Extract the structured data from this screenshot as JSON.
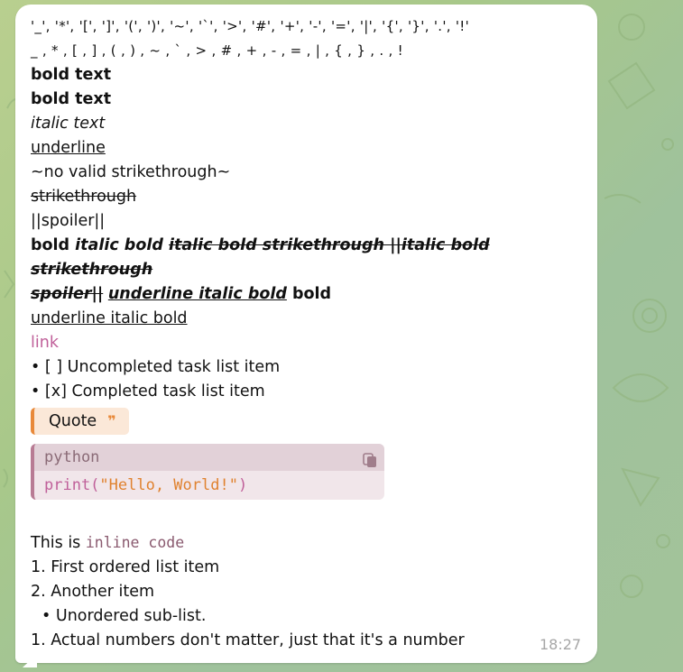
{
  "message": {
    "escaped_symbols": "'_', '*', '[', ']', '(', ')', '~', '`', '>', '#', '+', '-', '=', '|', '{', '}', '.', '!'",
    "plain_symbols": "_ , * , [ , ] , ( , ) , ~ , ` , > , # , + , - , = , | , { , } , . , !",
    "bold_1": "bold text",
    "bold_2": "bold text",
    "italic": "italic text",
    "underline": "underline",
    "invalid_strike": "~no valid strikethrough~",
    "strike": "strikethrough",
    "spoiler": "||spoiler||",
    "mixed": {
      "bold": "bold ",
      "italic_bold": "italic bold ",
      "italic_bold_strike": "italic bold strikethrough ||italic bold strikethrough",
      "spoiler_end": "spoiler||",
      "underline_italic_bold": "underline italic bold",
      "bold_end": " bold"
    },
    "underline_italic_bold": "underline italic bold",
    "link": "link",
    "task_1": "• [ ] Uncompleted task list item",
    "task_2": "• [x] Completed task list item",
    "quote": "Quote",
    "code": {
      "language": "python",
      "fn": "print(",
      "string": "\"Hello, World!\"",
      "close": ")"
    },
    "inline_prefix": "This is ",
    "inline_code": "inline code",
    "list_1": "1. First ordered list item",
    "list_2": "2. Another item",
    "sub_item": "• Unordered sub-list.",
    "list_3": "1. Actual numbers don't matter, just that it's a number",
    "time": "18:27"
  },
  "colors": {
    "link": "#c0609a",
    "quote_accent": "#e8893a",
    "code_accent": "#b87b94",
    "string": "#e0822f"
  }
}
